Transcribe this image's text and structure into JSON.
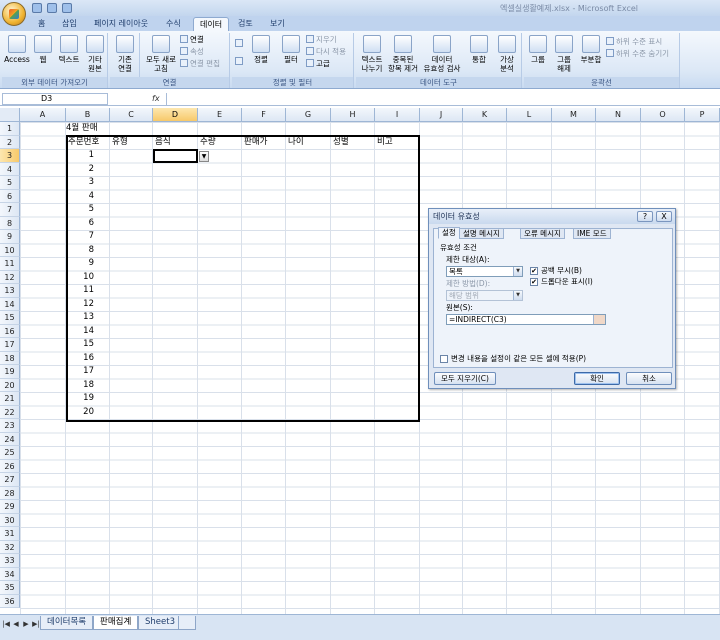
{
  "window": {
    "title": "엑셀실생활예제.xlsx - Microsoft Excel"
  },
  "tabs": [
    {
      "label": "홈",
      "active": false
    },
    {
      "label": "삽입",
      "active": false
    },
    {
      "label": "페이지 레이아웃",
      "active": false
    },
    {
      "label": "수식",
      "active": false
    },
    {
      "label": "데이터",
      "active": true
    },
    {
      "label": "검토",
      "active": false
    },
    {
      "label": "보기",
      "active": false
    }
  ],
  "ribbon": {
    "group_external": {
      "label": "외부 데이터 가져오기",
      "access": "Access",
      "web": "웹",
      "text": "텍스트",
      "other_line1": "기타",
      "other_line2": "원본"
    },
    "group_conn": {
      "label": "연결",
      "existing_line1": "기존",
      "existing_line2": "연결",
      "refresh_line1": "모두 새로",
      "refresh_line2": "고침",
      "connections": "연결",
      "properties": "속성",
      "edit_links": "연결 편집"
    },
    "group_sort": {
      "label": "정렬 및 필터",
      "sort": "정렬",
      "filter": "필터",
      "clear": "지우기",
      "reapply": "다시 적용",
      "advanced": "고급"
    },
    "group_tools": {
      "label": "데이터 도구",
      "text_to_col_line1": "텍스트",
      "text_to_col_line2": "나누기",
      "remove_dup_line1": "중복된",
      "remove_dup_line2": "항목 제거",
      "validation_line1": "데이터",
      "validation_line2": "유효성 검사",
      "consolidate": "통합",
      "whatif_line1": "가상",
      "whatif_line2": "분석"
    },
    "group_outline": {
      "label": "윤곽선",
      "group_btn": "그룹",
      "ungroup_line1": "그룹",
      "ungroup_line2": "해제",
      "subtotal": "부분합",
      "show_detail": "하위 수준 표시",
      "hide_detail": "하위 수준 숨기기"
    }
  },
  "formula_bar": {
    "name_box": "D3",
    "fx": "fx",
    "value": ""
  },
  "columns": [
    "A",
    "B",
    "C",
    "D",
    "E",
    "F",
    "G",
    "H",
    "I",
    "J",
    "K",
    "L",
    "M",
    "N",
    "O",
    "P"
  ],
  "rows": [
    "1",
    "2",
    "3",
    "4",
    "5",
    "6",
    "7",
    "8",
    "9",
    "10",
    "11",
    "12",
    "13",
    "14",
    "15",
    "16",
    "17",
    "18",
    "19",
    "20",
    "21",
    "22",
    "23",
    "24",
    "25",
    "26",
    "27",
    "28",
    "29",
    "30",
    "31",
    "32",
    "33",
    "34",
    "35",
    "36"
  ],
  "sheet": {
    "title": "4월 판매",
    "headers": [
      "주문번호",
      "유형",
      "음식",
      "수량",
      "판매가",
      "나이",
      "성별",
      "비고"
    ],
    "order_numbers": [
      "1",
      "2",
      "3",
      "4",
      "5",
      "6",
      "7",
      "8",
      "9",
      "10",
      "11",
      "12",
      "13",
      "14",
      "15",
      "16",
      "17",
      "18",
      "19",
      "20"
    ]
  },
  "sheet_tabs": [
    {
      "label": "데이터목록",
      "active": false
    },
    {
      "label": "판매집계",
      "active": true
    },
    {
      "label": "Sheet3",
      "active": false
    }
  ],
  "dialog": {
    "title": "데이터 유효성",
    "help": "?",
    "close": "X",
    "tabs": [
      "설정",
      "설명 메시지",
      "오류 메시지",
      "IME 모드"
    ],
    "criteria_label": "유효성 조건",
    "allow_label": "제한 대상(A):",
    "allow_value": "목록",
    "ignore_blank": "공백 무시(B)",
    "in_cell_dropdown": "드롭다운 표시(I)",
    "data_label": "제한 방법(D):",
    "data_value": "해당 범위",
    "source_label": "원본(S):",
    "source_value": "=INDIRECT(C3)",
    "apply_all": "변경 내용을 설정이 같은 모든 셀에 적용(P)",
    "clear_all": "모두 지우기(C)",
    "ok": "확인",
    "cancel": "취소"
  }
}
